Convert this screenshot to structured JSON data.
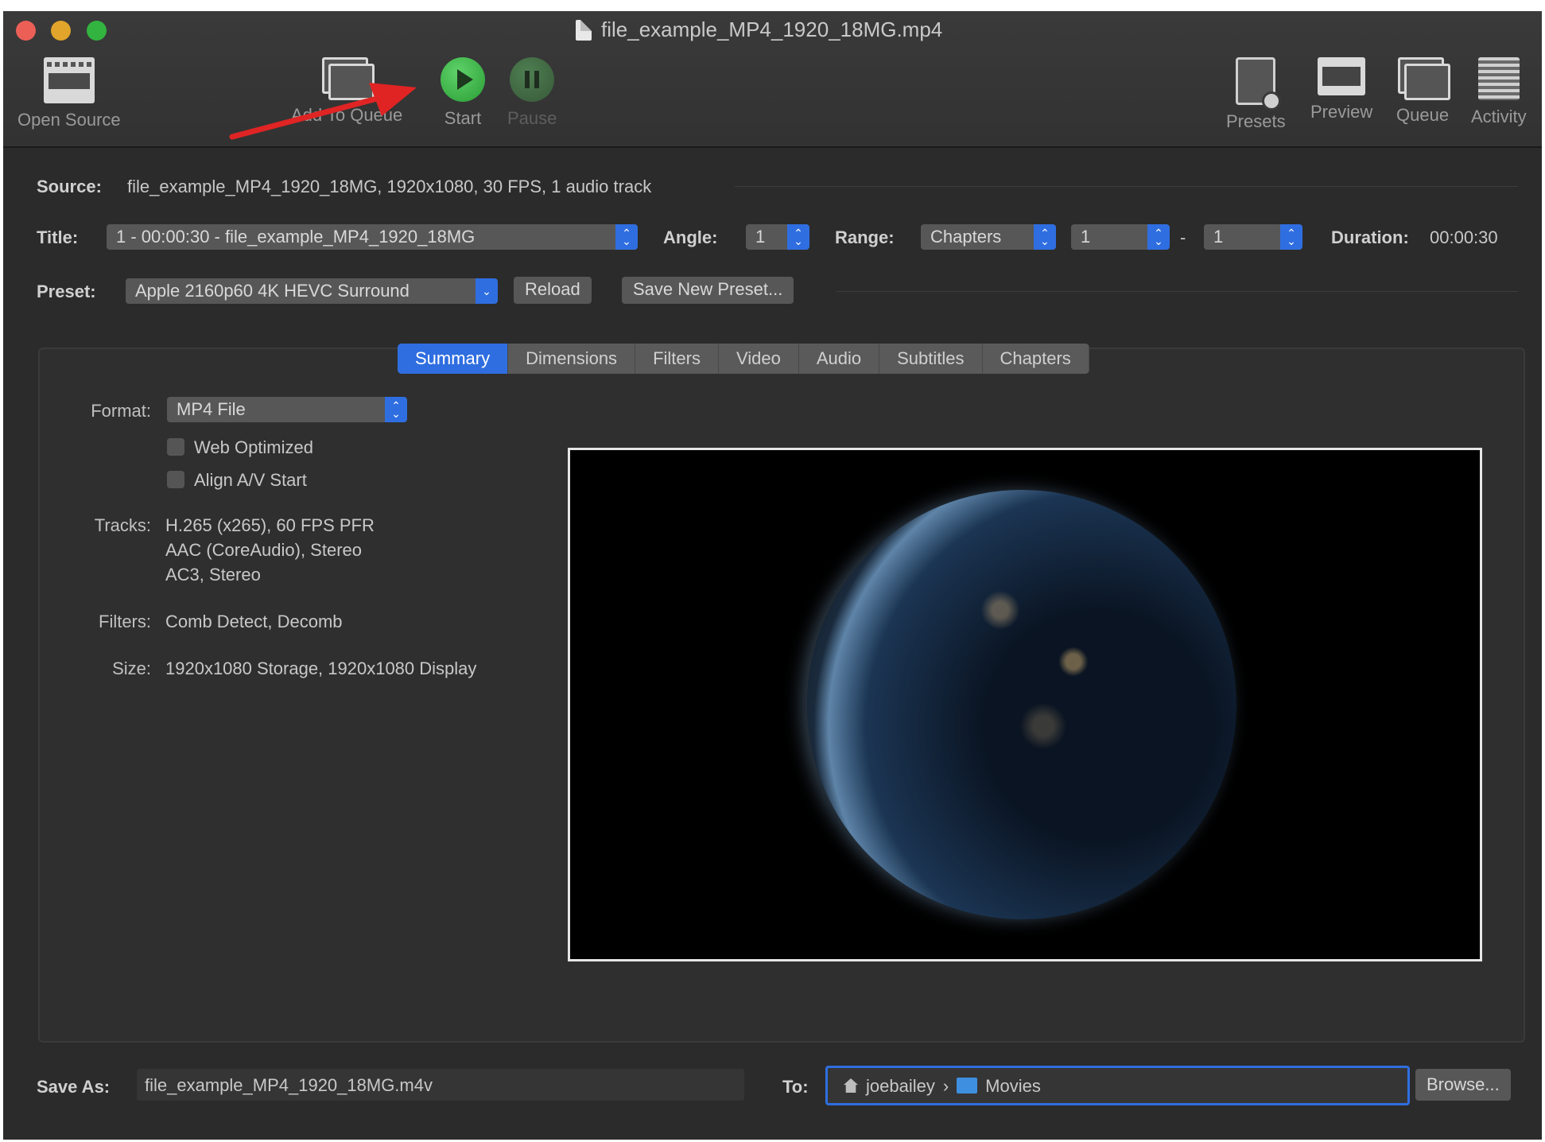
{
  "window": {
    "title": "file_example_MP4_1920_18MG.mp4"
  },
  "toolbar": {
    "open_source": "Open Source",
    "add_to_queue": "Add To Queue",
    "start": "Start",
    "pause": "Pause",
    "presets": "Presets",
    "preview": "Preview",
    "queue": "Queue",
    "activity": "Activity"
  },
  "source": {
    "label": "Source:",
    "value": "file_example_MP4_1920_18MG, 1920x1080, 30 FPS, 1 audio track"
  },
  "title_row": {
    "title_label": "Title:",
    "title_value": "1 - 00:00:30 - file_example_MP4_1920_18MG",
    "angle_label": "Angle:",
    "angle_value": "1",
    "range_label": "Range:",
    "range_type": "Chapters",
    "range_start": "1",
    "range_dash": "-",
    "range_end": "1",
    "duration_label": "Duration:",
    "duration_value": "00:00:30"
  },
  "preset_row": {
    "label": "Preset:",
    "value": "Apple 2160p60 4K HEVC Surround",
    "reload": "Reload",
    "save_new": "Save New Preset..."
  },
  "tabs": [
    "Summary",
    "Dimensions",
    "Filters",
    "Video",
    "Audio",
    "Subtitles",
    "Chapters"
  ],
  "summary": {
    "format_label": "Format:",
    "format_value": "MP4 File",
    "web_optimized": "Web Optimized",
    "align_av": "Align A/V Start",
    "tracks_label": "Tracks:",
    "tracks": [
      "H.265 (x265), 60 FPS PFR",
      "AAC (CoreAudio), Stereo",
      "AC3, Stereo"
    ],
    "filters_label": "Filters:",
    "filters_value": "Comb Detect, Decomb",
    "size_label": "Size:",
    "size_value": "1920x1080 Storage, 1920x1080 Display"
  },
  "save": {
    "label": "Save As:",
    "value": "file_example_MP4_1920_18MG.m4v",
    "to_label": "To:",
    "path_home": "joebailey",
    "path_sep": "›",
    "path_folder": "Movies",
    "browse": "Browse..."
  },
  "colors": {
    "accent": "#2f6ee0",
    "start_green": "#33b33f",
    "annotation_arrow": "#e02424"
  }
}
